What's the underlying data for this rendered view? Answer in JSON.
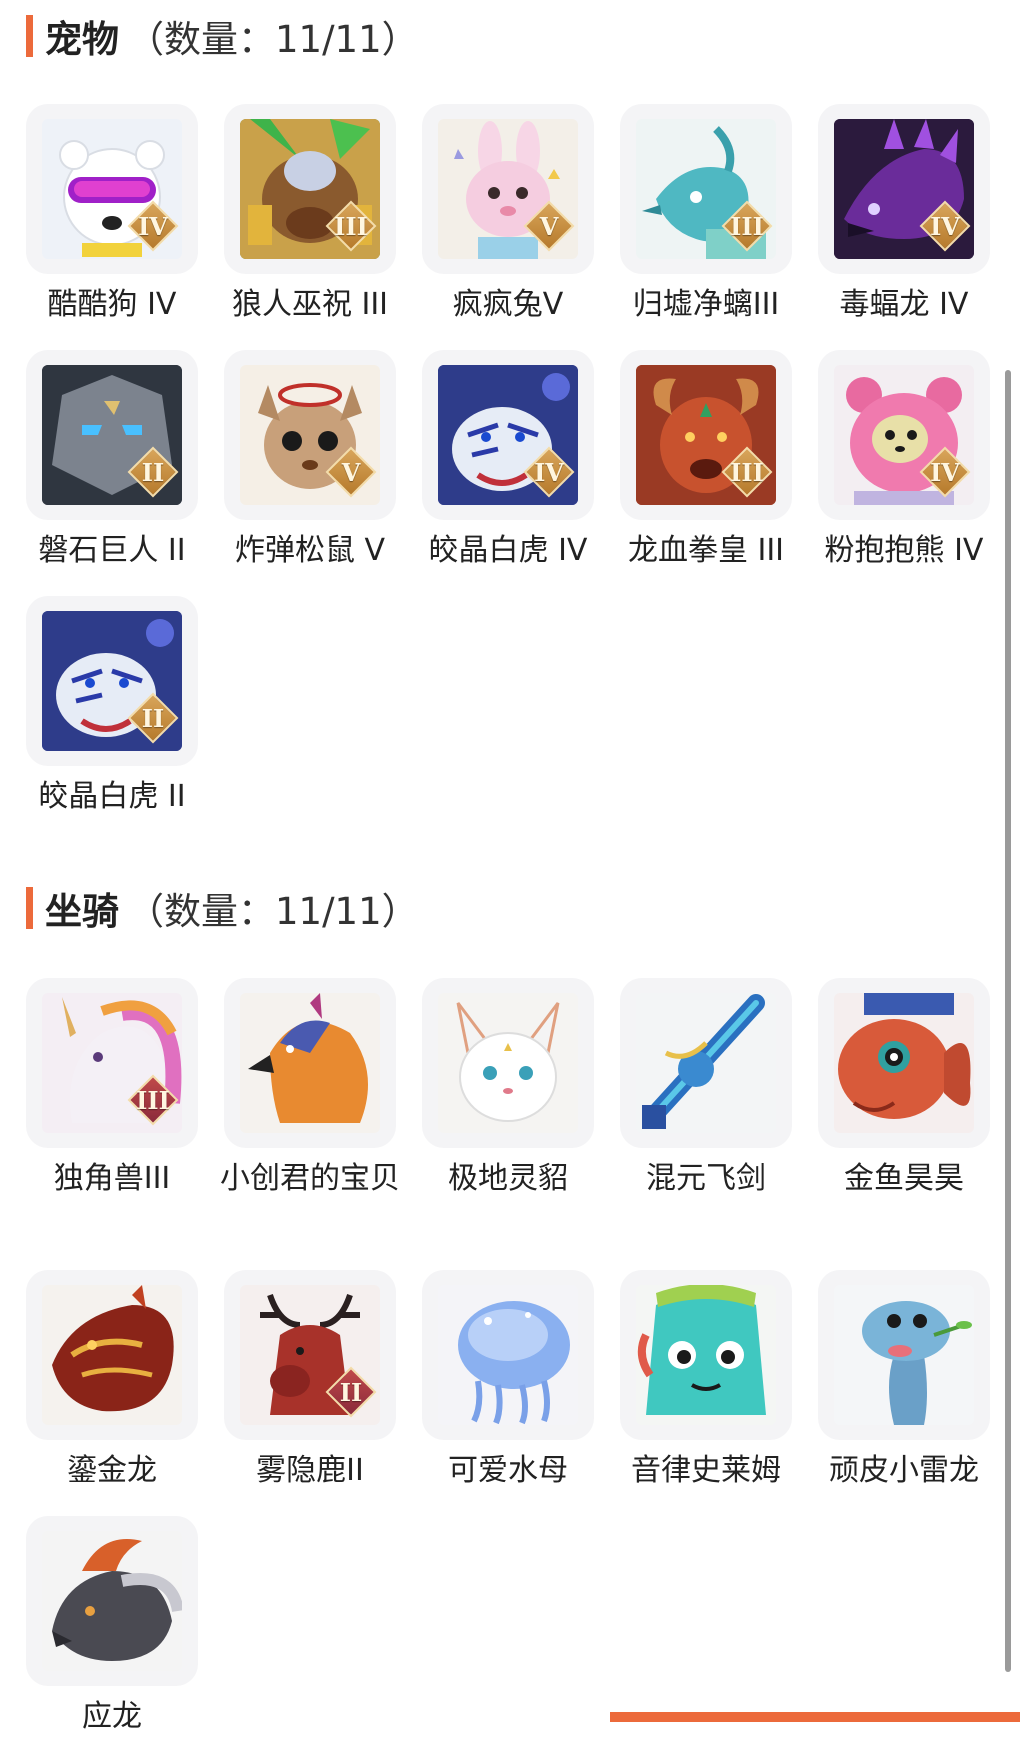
{
  "accent_color": "#ec6a3b",
  "pets": {
    "title": "宠物",
    "count": "（数量：11/11）",
    "items": [
      {
        "name": "酷酷狗 IV",
        "tier": "IV",
        "icon": "cool-dog-icon"
      },
      {
        "name": "狼人巫祝 III",
        "tier": "III",
        "icon": "werewolf-shaman-icon"
      },
      {
        "name": "疯疯兔V",
        "tier": "V",
        "icon": "crazy-rabbit-icon"
      },
      {
        "name": "归墟净螭III",
        "tier": "III",
        "icon": "water-dragon-icon"
      },
      {
        "name": "毒蝠龙 IV",
        "tier": "IV",
        "icon": "poison-bat-dragon-icon"
      },
      {
        "name": "磐石巨人 II",
        "tier": "II",
        "icon": "rock-giant-icon"
      },
      {
        "name": "炸弹松鼠 V",
        "tier": "V",
        "icon": "bomb-squirrel-icon"
      },
      {
        "name": "皎晶白虎 IV",
        "tier": "IV",
        "icon": "crystal-white-tiger-icon"
      },
      {
        "name": "龙血拳皇 III",
        "tier": "III",
        "icon": "dragon-blood-boxer-icon"
      },
      {
        "name": "粉抱抱熊 IV",
        "tier": "IV",
        "icon": "pink-hug-bear-icon"
      },
      {
        "name": "皎晶白虎 II",
        "tier": "II",
        "icon": "crystal-white-tiger-icon"
      }
    ]
  },
  "mounts": {
    "title": "坐骑",
    "count": "（数量：11/11）",
    "items": [
      {
        "name": "独角兽III",
        "tier": "III",
        "icon": "unicorn-icon"
      },
      {
        "name": "小创君的宝贝",
        "tier": "",
        "icon": "phoenix-icon"
      },
      {
        "name": "极地灵貂",
        "tier": "",
        "icon": "polar-mink-icon"
      },
      {
        "name": "混元飞剑",
        "tier": "",
        "icon": "flying-sword-icon"
      },
      {
        "name": "金鱼昊昊",
        "tier": "",
        "icon": "goldfish-icon"
      },
      {
        "name": "鎏金龙",
        "tier": "",
        "icon": "gilded-dragon-icon"
      },
      {
        "name": "雾隐鹿II",
        "tier": "II",
        "icon": "mist-deer-icon"
      },
      {
        "name": "可爱水母",
        "tier": "",
        "icon": "jellyfish-icon"
      },
      {
        "name": "音律史莱姆",
        "tier": "",
        "icon": "melody-slime-icon"
      },
      {
        "name": "顽皮小雷龙",
        "tier": "",
        "icon": "naughty-brontosaurus-icon"
      },
      {
        "name": "应龙",
        "tier": "",
        "icon": "winged-dragon-icon"
      }
    ]
  }
}
